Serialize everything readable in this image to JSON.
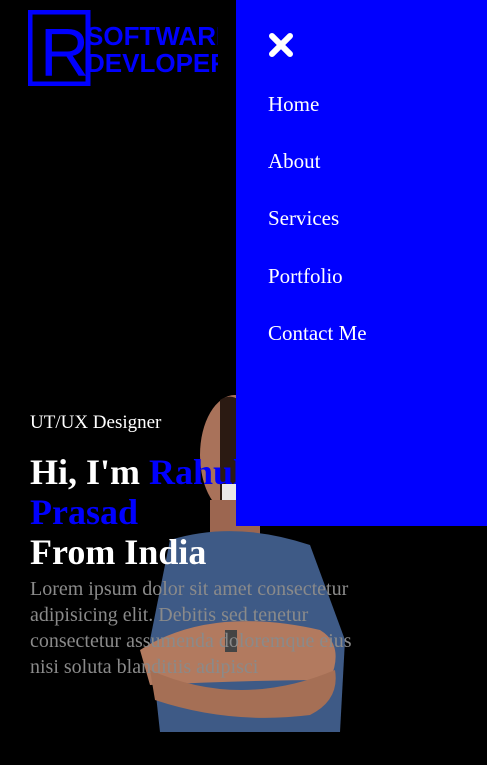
{
  "logo": {
    "letter": "R",
    "line1": "SOFTWARE",
    "line2": "DEVLOPER"
  },
  "menu": {
    "close_icon": "close-icon",
    "items": [
      {
        "label": "Home"
      },
      {
        "label": "About"
      },
      {
        "label": "Services"
      },
      {
        "label": "Portfolio"
      },
      {
        "label": "Contact Me"
      }
    ]
  },
  "hero": {
    "subtitle": "UT/UX Designer",
    "greeting": "Hi, I'm ",
    "first_name": "Rahul",
    "last_name": "Prasad",
    "origin": "From India",
    "paragraph": "Lorem ipsum dolor sit amet consectetur adipisicing elit. Debitis sed tenetur consectetur assumenda doloremque eius nisi soluta blanditiis adipisci"
  },
  "colors": {
    "accent": "#0000ff",
    "background": "#000000",
    "text": "#ffffff",
    "muted": "#8a8a8a"
  }
}
